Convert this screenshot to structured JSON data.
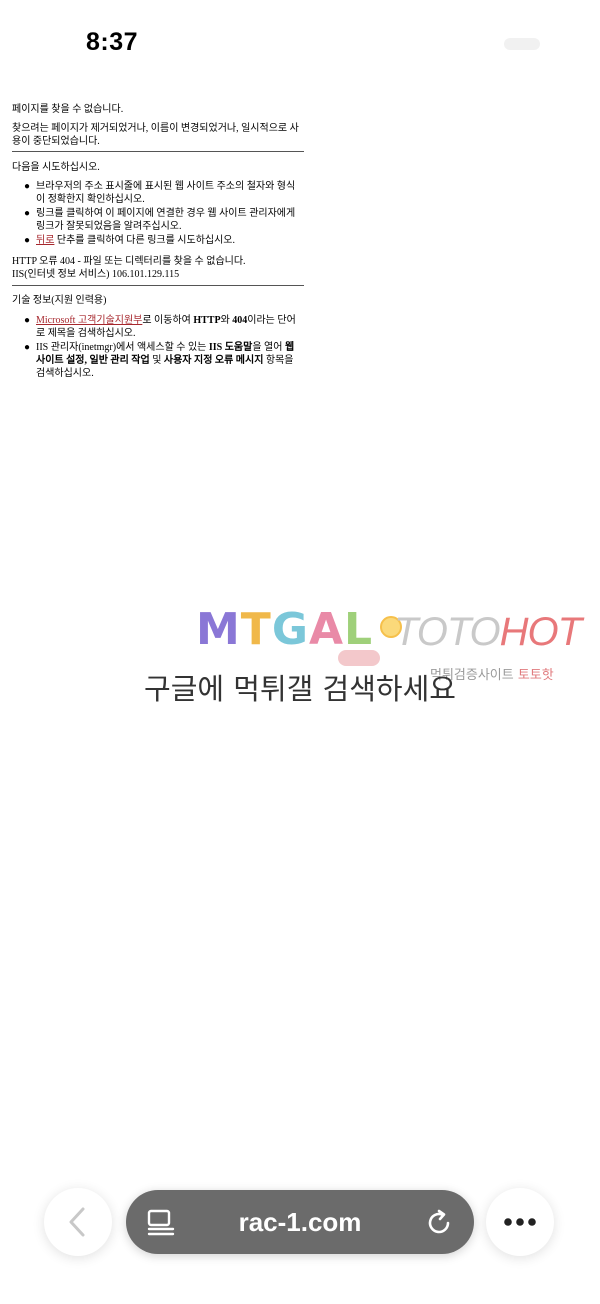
{
  "status_bar": {
    "time": "8:37"
  },
  "error_page": {
    "title": "페이지를 찾을 수 없습니다.",
    "description": "찾으려는 페이지가 제거되었거나, 이름이 변경되었거나, 일시적으로 사용이 중단되었습니다.",
    "try_heading": "다음을 시도하십시오.",
    "try_items": [
      "브라우저의 주소 표시줄에 표시된 웹 사이트 주소의 철자와 형식이 정확한지 확인하십시오.",
      "링크를 클릭하여 이 페이지에 연결한 경우 웹 사이트 관리자에게 링크가 잘못되었음을 알려주십시오."
    ],
    "back_link": "뒤로",
    "back_suffix": " 단추를 클릭하여 다른 링크를 시도하십시오.",
    "http_error": "HTTP 오류 404 - 파일 또는 디렉터리를 찾을 수 없습니다.",
    "server_info": "IIS(인터넷 정보 서비스) 106.101.129.115",
    "tech_heading": "기술 정보(지원 인력용)",
    "tech_item1": {
      "link": "Microsoft 고객기술지원부",
      "part1": "로 이동하여 ",
      "bold1": "HTTP",
      "part2": "와 ",
      "bold2": "404",
      "part3": "이라는 단어로 제목을 검색하십시오."
    },
    "tech_item2": {
      "part1": "IIS 관리자(inetmgr)에서 액세스할 수 있는 ",
      "bold1": "IIS 도움말",
      "part2": "을 열어 ",
      "bold2": "웹 사이트 설정, 일반 관리 작업",
      "part3": " 및 ",
      "bold3": "사용자 지정 오류 메시지",
      "part4": " 항목을 검색하십시오."
    }
  },
  "watermark": {
    "logo_letters": [
      "M",
      "T",
      "G",
      "A",
      "L"
    ],
    "brand_toto": "TOTO",
    "brand_hot": "HOT",
    "sub_text": "먹튀검증사이트 ",
    "sub_accent": "토토핫",
    "search_text": "구글에 먹튀갤 검색하세요"
  },
  "toolbar": {
    "url": "rac-1.com",
    "icons": [
      "chevron-left-icon",
      "reader-icon",
      "reload-icon",
      "more-icon"
    ]
  },
  "colors": {
    "link": "#a6262c",
    "address_bar": "#6b6b6b",
    "brand_hot": "#e8787a"
  }
}
